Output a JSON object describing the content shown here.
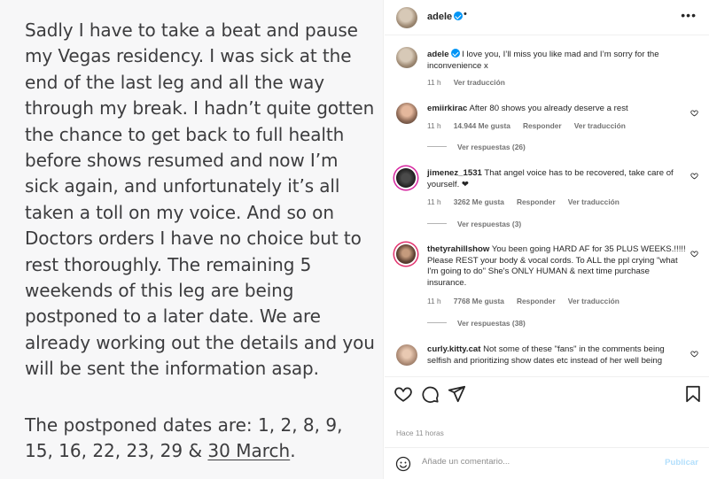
{
  "statement": {
    "body": "Sadly I have to take a beat and pause my Vegas residency. I was sick at the end of the last leg and all the way through my break. I hadn’t quite gotten the chance to get back to full health before shows resumed and now I’m sick again, and unfortunately it’s all taken a toll on my voice. And so on Doctors orders I have no choice but to rest thoroughly. The remaining 5 weekends of this leg are being postponed to a later date. We are already working out the details and you will be sent the information asap.",
    "dates_prefix": "The postponed dates are: 1, 2, 8, 9, 15, 16, 22, 23, 29 & ",
    "dates_underlined": "30 March",
    "dates_suffix": "."
  },
  "post_header": {
    "username": "adele",
    "dot": "•",
    "more_icon": "more-horizontal-icon"
  },
  "caption": {
    "username": "adele",
    "text": "I love you, I’ll miss you like mad and I’m sorry for the inconvenience x",
    "time": "11 h",
    "translate": "Ver traducción"
  },
  "comments": [
    {
      "username": "emiirkirac",
      "text": "After 80 shows you already deserve a rest",
      "time": "11 h",
      "likes": "14.944 Me gusta",
      "reply": "Responder",
      "translate": "Ver traducción",
      "replies": "Ver respuestas (26)"
    },
    {
      "username": "jimenez_1531",
      "text": "That angel voice has to be recovered, take care of yourself. ❤",
      "time": "11 h",
      "likes": "3262 Me gusta",
      "reply": "Responder",
      "translate": "Ver traducción",
      "replies": "Ver respuestas (3)"
    },
    {
      "username": "thetyrahillshow",
      "text": "You been going HARD AF for 35 PLUS WEEKS.!!!!! Please REST your body & vocal cords. To ALL the ppl crying \"what I'm going to do\" She's ONLY HUMAN & next time purchase insurance.",
      "time": "11 h",
      "likes": "7768 Me gusta",
      "reply": "Responder",
      "translate": "Ver traducción",
      "replies": "Ver respuestas (38)"
    },
    {
      "username": "curly.kitty.cat",
      "text": "Not some of these \"fans\" in the comments being selfish and prioritizing show dates etc instead of her well being"
    }
  ],
  "actions": {
    "like_icon": "heart-icon",
    "comment_icon": "comment-bubble-icon",
    "share_icon": "paper-plane-icon",
    "save_icon": "bookmark-icon"
  },
  "posted_time": "Hace 11 horas",
  "add_comment": {
    "placeholder": "Añade un comentario...",
    "publish": "Publicar",
    "emoji_icon": "smiley-icon"
  },
  "colors": {
    "verified": "#0095f6",
    "publish_disabled": "#b2dffc",
    "secondary_text": "#737373"
  }
}
